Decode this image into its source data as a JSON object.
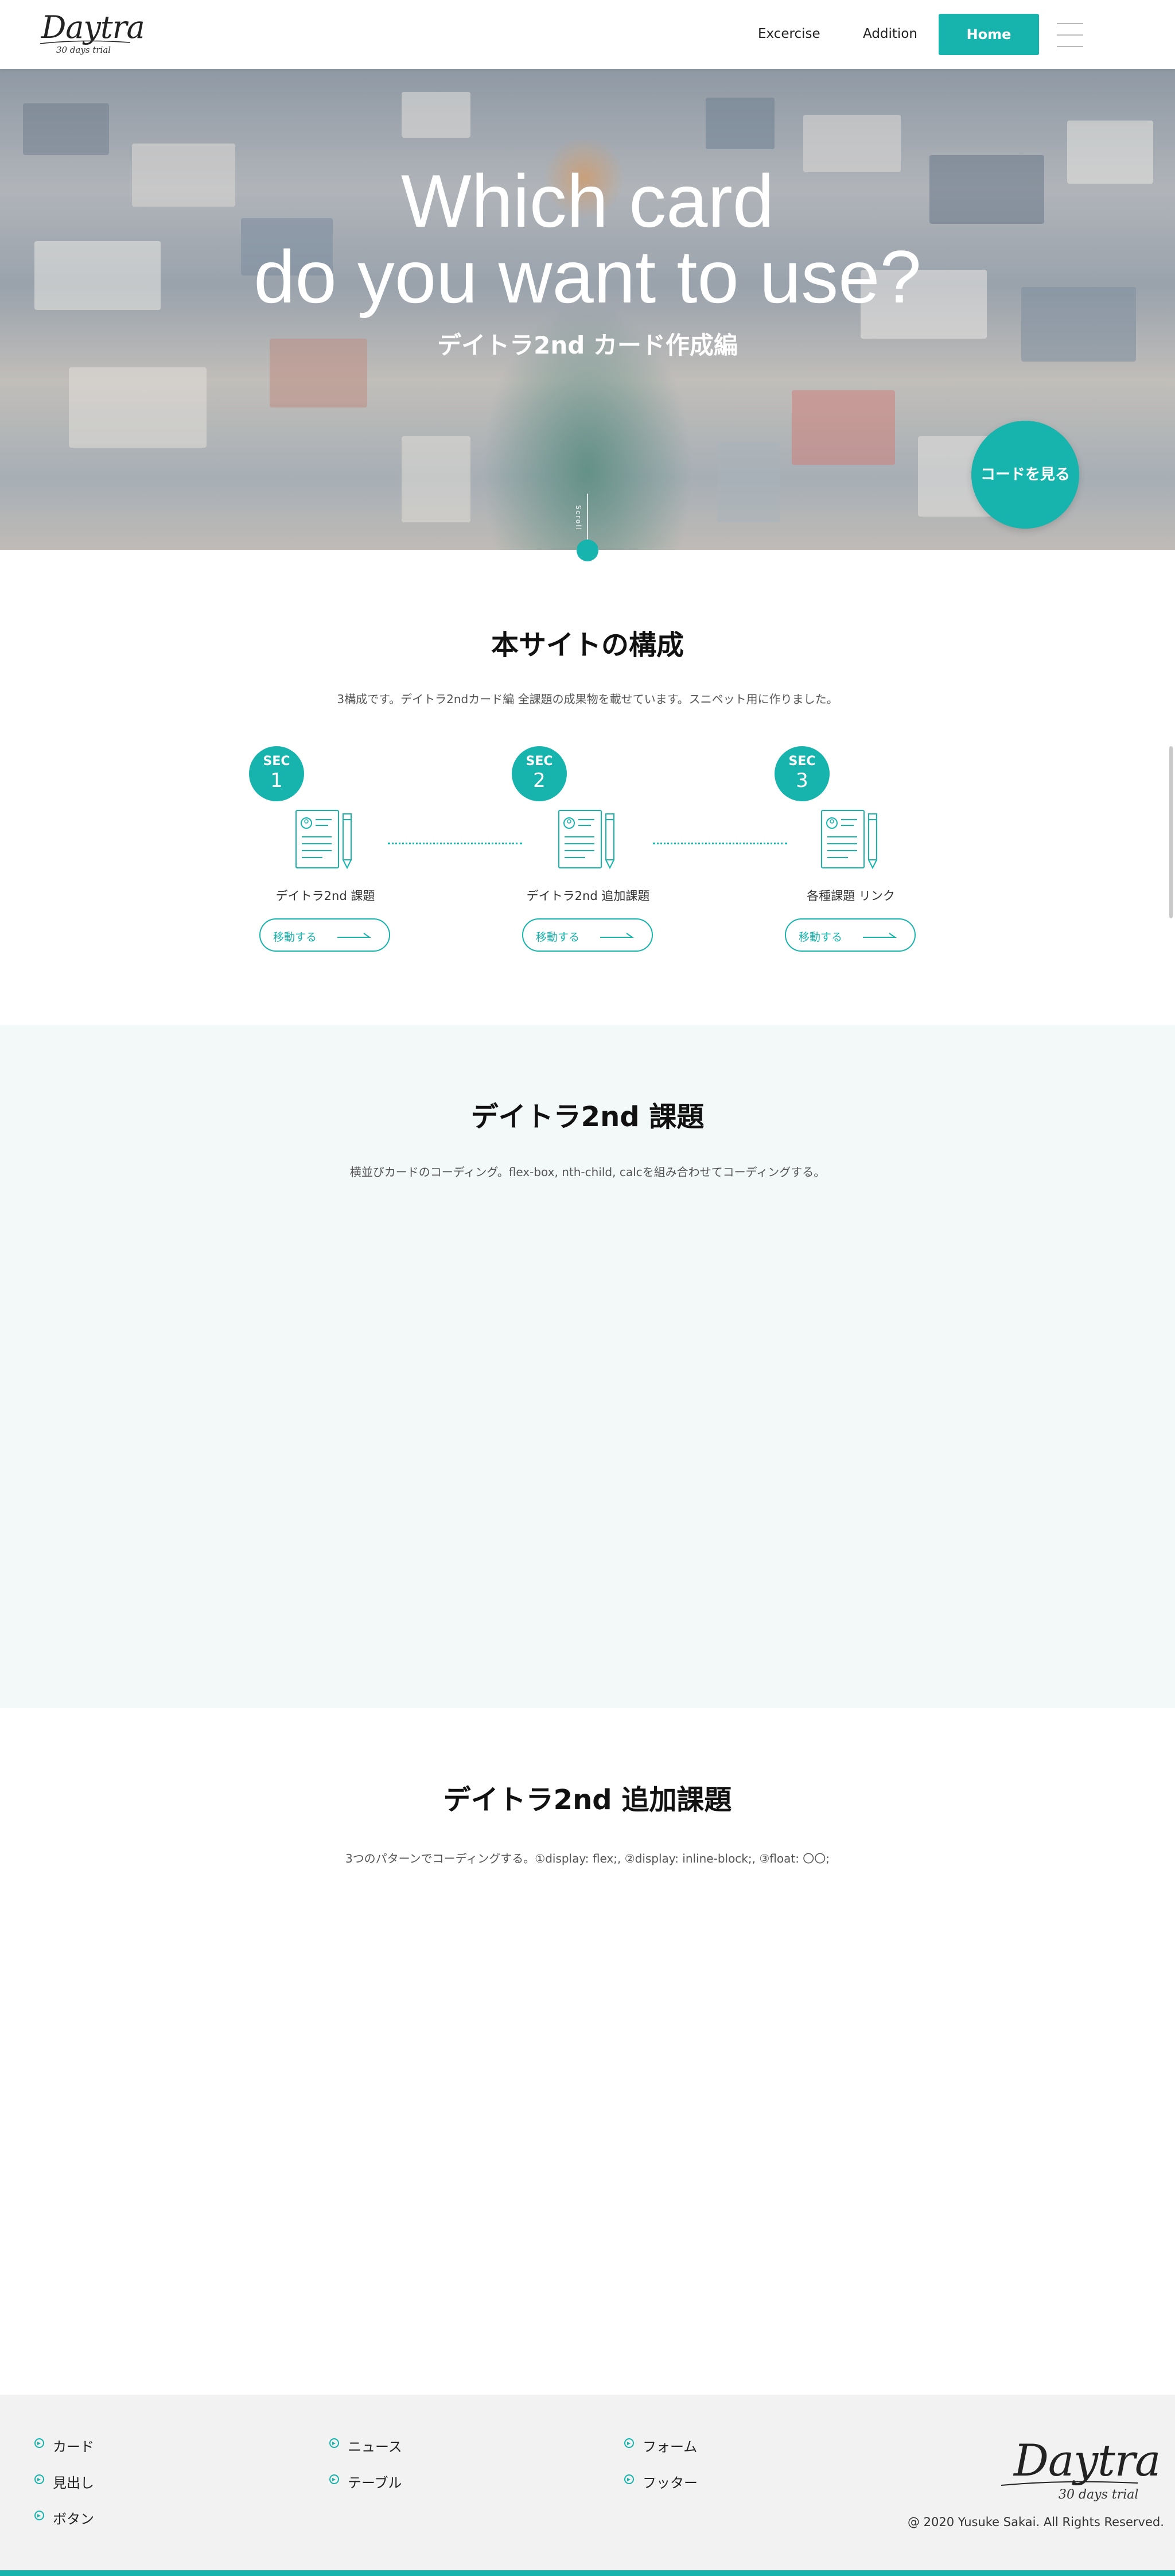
{
  "header": {
    "logo_text": "Daytra",
    "logo_sub": "30 days trial",
    "nav": [
      {
        "label": "Excercise"
      },
      {
        "label": "Addition"
      }
    ],
    "home_label": "Home"
  },
  "hero": {
    "title_line1": "Which card",
    "title_line2": "do you want to use?",
    "subtitle": "デイトラ2nd カード作成編",
    "code_button": "コードを見る",
    "scroll_label": "Scroll"
  },
  "structure": {
    "title": "本サイトの構成",
    "description": "3構成です。デイトラ2ndカード編 全課題の成果物を載せています。スニペット用に作りました。",
    "steps": [
      {
        "sec": "SEC",
        "num": "1",
        "label": "デイトラ2nd 課題",
        "button": "移動する"
      },
      {
        "sec": "SEC",
        "num": "2",
        "label": "デイトラ2nd 追加課題",
        "button": "移動する"
      },
      {
        "sec": "SEC",
        "num": "3",
        "label": "各種課題 リンク",
        "button": "移動する"
      }
    ]
  },
  "task": {
    "title": "デイトラ2nd 課題",
    "description": "横並びカードのコーディング。flex-box, nth-child, calcを組み合わせてコーディングする。"
  },
  "extra": {
    "title": "デイトラ2nd 追加課題",
    "description": "3つのパターンでコーディングする。①display: flex;, ②display: inline-block;, ③float: 〇〇;"
  },
  "footer": {
    "links": [
      "カード",
      "見出し",
      "ボタン",
      "ニュース",
      "テーブル",
      "フォーム",
      "フッター"
    ],
    "logo_text": "Daytra",
    "logo_sub": "30 days trial",
    "copyright": "@ 2020 Yusuke Sakai. All Rights Reserved."
  },
  "colors": {
    "accent": "#17b3ad",
    "section_bg": "#f3f9f9",
    "footer_bg": "#f2f2f2"
  }
}
